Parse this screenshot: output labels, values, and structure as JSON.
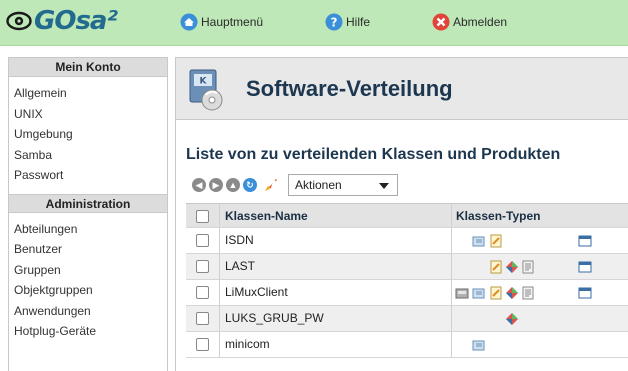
{
  "header": {
    "logo": "GOsa²",
    "nav": [
      {
        "label": "Hauptmenü",
        "icon": "home-icon"
      },
      {
        "label": "Hilfe",
        "icon": "help-icon"
      },
      {
        "label": "Abmelden",
        "icon": "logout-icon"
      }
    ]
  },
  "sidebar": {
    "account_title": "Mein Konto",
    "account_items": [
      "Allgemein",
      "UNIX",
      "Umgebung",
      "Samba",
      "Passwort"
    ],
    "admin_title": "Administration",
    "admin_items": [
      "Abteilungen",
      "Benutzer",
      "Gruppen",
      "Objektgruppen",
      "Anwendungen",
      "Hotplug-Geräte"
    ]
  },
  "main": {
    "page_title": "Software-Verteilung",
    "list_title": "Liste von zu verteilenden Klassen und Produkten",
    "actions_label": "Aktionen",
    "table": {
      "headers": [
        "Klassen-Name",
        "Klassen-Typen"
      ],
      "rows": [
        {
          "name": "ISDN",
          "types": [
            "packages",
            "script",
            "window"
          ]
        },
        {
          "name": "LAST",
          "types": [
            "script",
            "hook",
            "template",
            "window"
          ]
        },
        {
          "name": "LiMuxClient",
          "types": [
            "disk",
            "packages",
            "script",
            "hook",
            "template",
            "window"
          ]
        },
        {
          "name": "LUKS_GRUB_PW",
          "types": [
            "hook"
          ]
        },
        {
          "name": "minicom",
          "types": [
            "packages"
          ]
        }
      ]
    }
  },
  "colors": {
    "header_bg": "#bfe8b8",
    "title_text": "#1d3750",
    "logo_text": "#226b8e"
  }
}
